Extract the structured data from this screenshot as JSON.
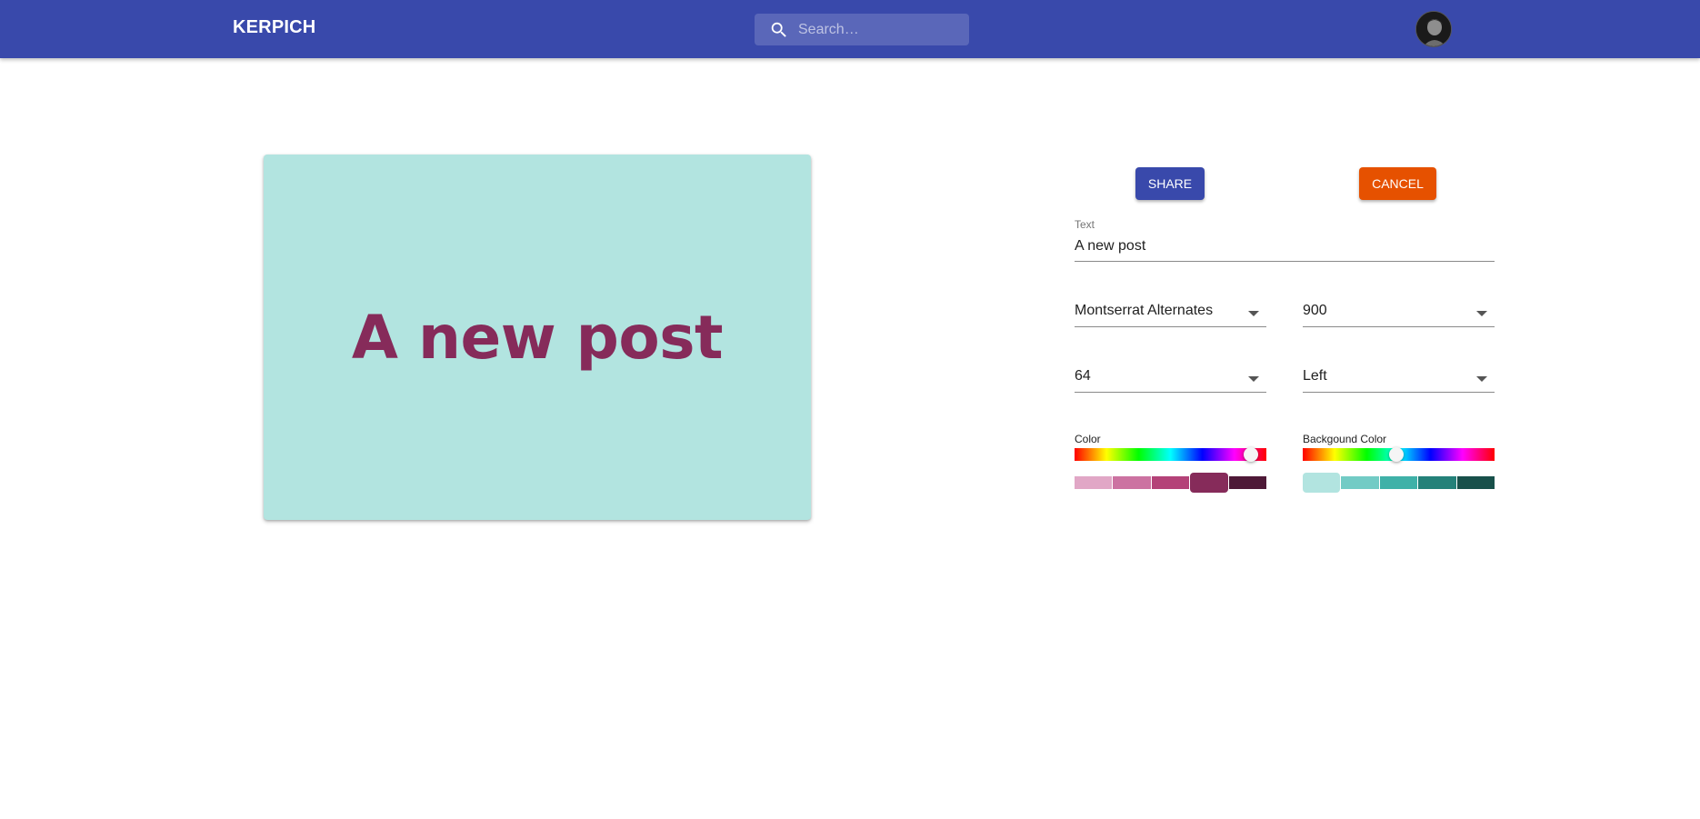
{
  "appbar": {
    "brand": "KERPICH",
    "search_placeholder": "Search…"
  },
  "canvas": {
    "text": "A new post",
    "text_color": "#862b5a",
    "background_color": "#b2e4e0"
  },
  "actions": {
    "share_label": "SHARE",
    "cancel_label": "CANCEL"
  },
  "text_field": {
    "label": "Text",
    "value": "A new post"
  },
  "selects": {
    "font_family": "Montserrat Alternates",
    "font_weight": "900",
    "font_size": "64",
    "alignment": "Left"
  },
  "color_picker": {
    "label": "Color",
    "hue_position_fraction": 0.92,
    "swatches": [
      "#e1a7c6",
      "#cc72a1",
      "#b44278",
      "#862b5a",
      "#4e1937"
    ],
    "selected_index": 3
  },
  "background_picker": {
    "label": "Backgound Color",
    "hue_position_fraction": 0.49,
    "swatches": [
      "#b2e4e0",
      "#72cbc5",
      "#3fb1a8",
      "#248179",
      "#18504a"
    ],
    "selected_index": 0
  },
  "colors": {
    "appbar": "#3949ab",
    "share_button": "#3949ab",
    "cancel_button": "#e65100"
  }
}
